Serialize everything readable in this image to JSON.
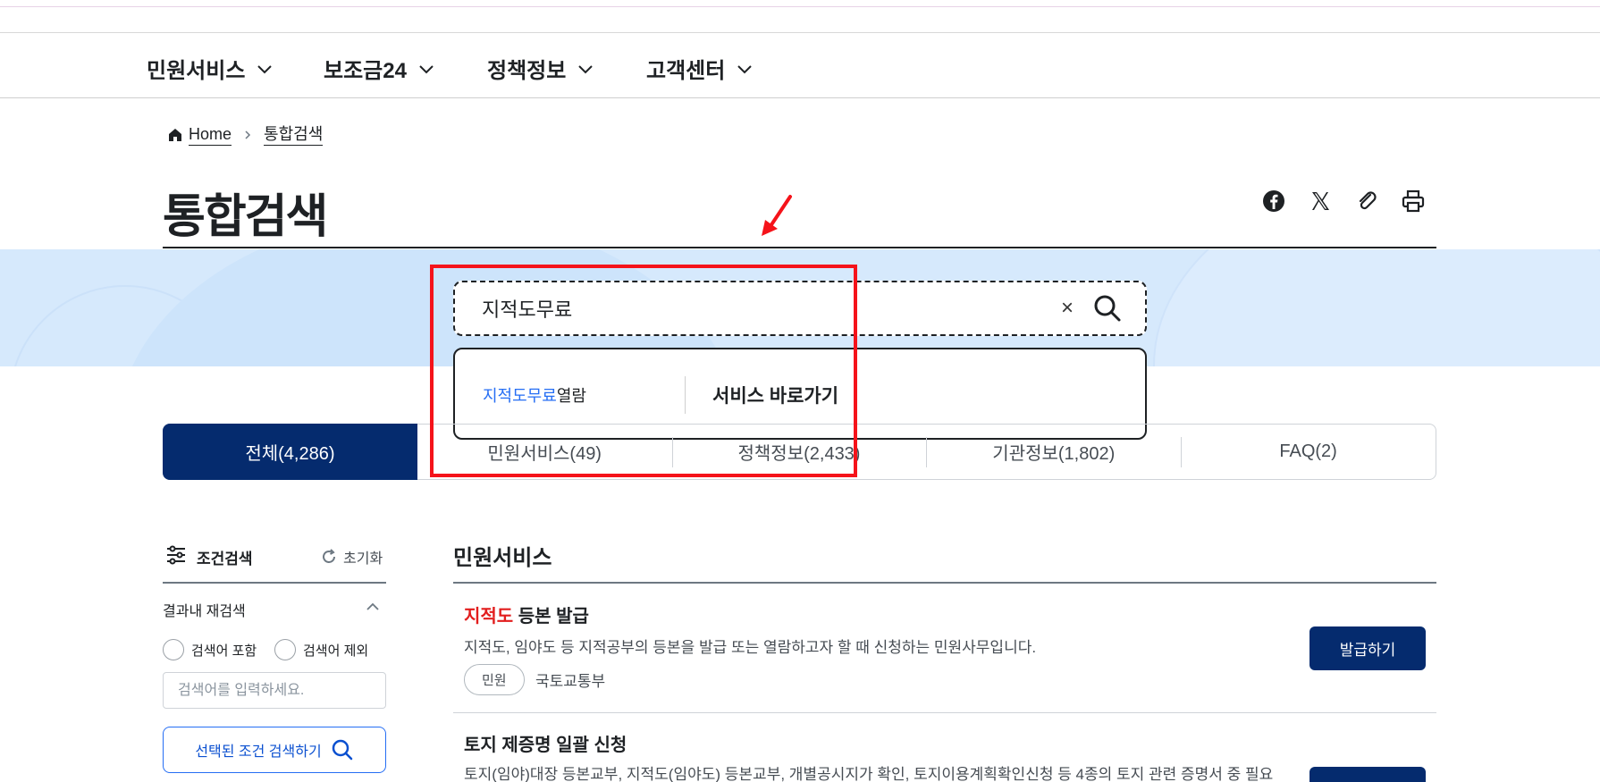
{
  "gnb": {
    "items": [
      {
        "label": "민원서비스"
      },
      {
        "label": "보조금24"
      },
      {
        "label": "정책정보"
      },
      {
        "label": "고객센터"
      }
    ]
  },
  "breadcrumb": {
    "home": "Home",
    "current": "통합검색"
  },
  "page_title": "통합검색",
  "share": {
    "icons": [
      "facebook-icon",
      "x-icon",
      "paperclip-icon",
      "print-icon"
    ]
  },
  "search": {
    "value": "지적도무료",
    "clear_glyph": "×"
  },
  "suggest": {
    "keyword_match": "지적도무료",
    "keyword_rest": "열람",
    "go_label": "서비스 바로가기"
  },
  "tabs": [
    {
      "label": "전체(4,286)",
      "active": true
    },
    {
      "label": "민원서비스(49)",
      "active": false
    },
    {
      "label": "정책정보(2,433)",
      "active": false
    },
    {
      "label": "기관정보(1,802)",
      "active": false
    },
    {
      "label": "FAQ(2)",
      "active": false
    }
  ],
  "filter": {
    "title": "조건검색",
    "reset": "초기화",
    "refine_title": "결과내 재검색",
    "include": "검색어 포함",
    "exclude": "검색어 제외",
    "placeholder": "검색어를 입력하세요.",
    "submit": "선택된 조건 검색하기"
  },
  "results": {
    "section_title": "민원서비스",
    "items": [
      {
        "title_keyword": "지적도",
        "title_rest": " 등본 발급",
        "desc": "지적도, 임야도 등 지적공부의 등본을 발급 또는 열람하고자 할 때 신청하는 민원사무입니다.",
        "tag": "민원",
        "org": "국토교통부",
        "button": "발급하기"
      },
      {
        "title": "토지 제증명 일괄 신청",
        "desc": "토지(임야)대장 등본교부, 지적도(임야도) 등본교부, 개별공시지가 확인, 토지이용계획확인신청 등 4종의 토지 관련 증명서 중 필요"
      }
    ]
  },
  "colors": {
    "primary_navy": "#052b6e",
    "accent_blue": "#256ef4",
    "highlight_red": "#f5131a",
    "band_blue": "#d6e9fc"
  }
}
